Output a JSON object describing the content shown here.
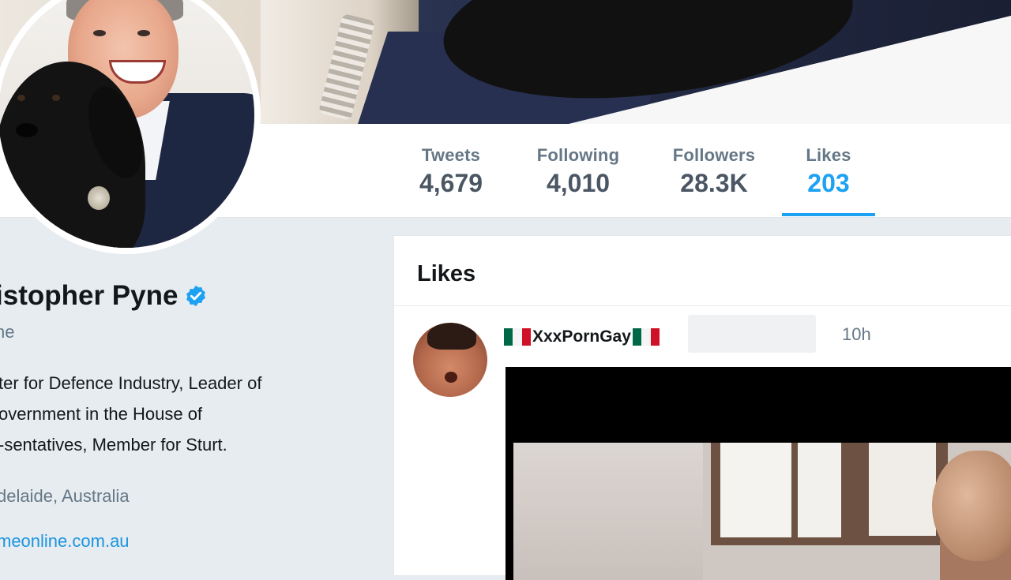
{
  "stats": [
    {
      "label": "Tweets",
      "value": "4,679"
    },
    {
      "label": "Following",
      "value": "4,010"
    },
    {
      "label": "Followers",
      "value": "28.3K"
    },
    {
      "label": "Likes",
      "value": "203"
    }
  ],
  "active_tab": "Likes",
  "profile": {
    "name": "istopher Pyne",
    "handle": "ne",
    "bio_lines": [
      "ter for Defence Industry, Leader of",
      "overnment in the House of",
      "-sentatives, Member for Sturt."
    ],
    "location": "delaide, Australia",
    "website": "meonline.com.au"
  },
  "feed": {
    "title": "Likes",
    "tweet": {
      "author": "XxxPornGay",
      "time": "10h"
    }
  },
  "colors": {
    "accent": "#1da1f2",
    "verified": "#1da1f2",
    "link": "#1b95e0",
    "text": "#14171a",
    "muted": "#657786"
  }
}
